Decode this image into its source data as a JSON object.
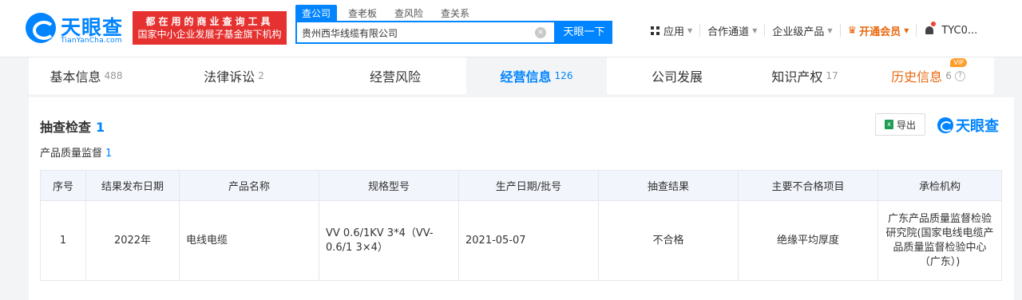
{
  "header": {
    "logo_cn": "天眼查",
    "logo_en": "TianYanCha.com",
    "banner_line1": "都在用的商业查询工具",
    "banner_line2": "国家中小企业发展子基金旗下机构",
    "search_tabs": [
      "查公司",
      "查老板",
      "查风险",
      "查关系"
    ],
    "search_value": "贵州西华线缆有限公司",
    "search_button": "天眼一下",
    "nav": {
      "apps": "应用",
      "partner": "合作通道",
      "enterprise": "企业级产品",
      "vip": "开通会员",
      "user": "TYC0..."
    }
  },
  "tabs": [
    {
      "label": "基本信息",
      "count": "488"
    },
    {
      "label": "法律诉讼",
      "count": "2"
    },
    {
      "label": "经营风险",
      "count": ""
    },
    {
      "label": "经营信息",
      "count": "126"
    },
    {
      "label": "公司发展",
      "count": ""
    },
    {
      "label": "知识产权",
      "count": "17"
    },
    {
      "label": "历史信息",
      "count": "6"
    }
  ],
  "vip_badge": "VIP",
  "section": {
    "title": "抽查检查",
    "count": "1",
    "subtitle": "产品质量监督",
    "sub_count": "1",
    "export_label": "导出",
    "brand": "天眼查"
  },
  "table": {
    "headers": [
      "序号",
      "结果发布日期",
      "产品名称",
      "规格型号",
      "生产日期/批号",
      "抽查结果",
      "主要不合格项目",
      "承检机构"
    ],
    "rows": [
      [
        "1",
        "2022年",
        "电线电缆",
        "VV 0.6/1KV 3*4（VV- 0.6/1 3×4）",
        "2021-05-07",
        "不合格",
        "绝缘平均厚度",
        "广东产品质量监督检验研究院(国家电线电缆产品质量监督检验中心（广东）)"
      ]
    ]
  }
}
